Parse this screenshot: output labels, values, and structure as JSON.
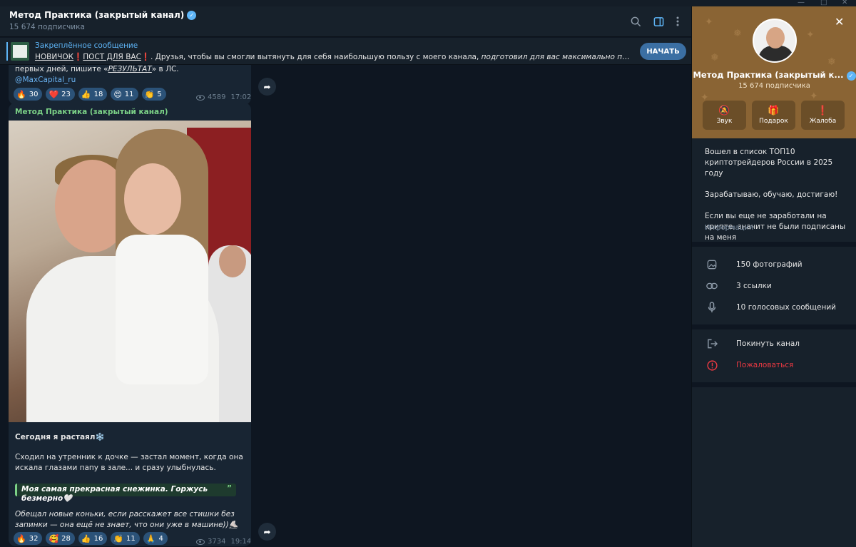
{
  "window": {
    "controls": [
      "—",
      "□",
      "✕"
    ]
  },
  "header": {
    "title": "Метод Практика (закрытый канал)",
    "subscribers": "15 674 подписчика"
  },
  "pinned": {
    "label": "Закреплённое сообщение",
    "part1": "НОВИЧОК",
    "part2": "ПОСТ ДЛЯ ВАС",
    "part3": ". Друзья, чтобы вы смогли вытянуть для себя наибольшую пользу с моего канала, ",
    "part4": "подготовил для вас максимально подробный гайд с от...",
    "button": "НАЧАТЬ"
  },
  "message1": {
    "line_a": "первых дней, пишите «",
    "line_b": "РЕЗУЛЬТАТ",
    "line_c": "» в ЛС.",
    "link": "@MaxCapital_ru",
    "reactions": [
      {
        "emoji": "🔥",
        "count": "30"
      },
      {
        "emoji": "❤️",
        "count": "23"
      },
      {
        "emoji": "👍",
        "count": "18"
      },
      {
        "emoji": "😍",
        "count": "11"
      },
      {
        "emoji": "👏",
        "count": "5"
      }
    ],
    "views": "4589",
    "time": "17:02"
  },
  "message2": {
    "author": "Метод Практика (закрытый канал)",
    "title": "Сегодня я растаял❄️",
    "body": "Сходил на утренник к дочке — застал момент, когда она искала глазами папу в зале... и сразу улыбнулась.",
    "quote": "Моя самая прекрасная снежинка. Горжусь безмерно🤍",
    "quote_mark": "”",
    "closing": "Обещал новые коньки, если расскажет все стишки без запинки — она ещё не знает, что они уже в машине))⛸️",
    "reactions": [
      {
        "emoji": "🔥",
        "count": "32"
      },
      {
        "emoji": "🥰",
        "count": "28"
      },
      {
        "emoji": "👍",
        "count": "16"
      },
      {
        "emoji": "👏",
        "count": "11"
      },
      {
        "emoji": "🙏",
        "count": "4"
      }
    ],
    "views": "3734",
    "time": "19:14"
  },
  "panel": {
    "name": "Метод Практика (закрытый к...",
    "subscribers": "15 674 подписчика",
    "buttons": [
      {
        "icon": "mute-icon",
        "label": "Звук"
      },
      {
        "icon": "gift-icon",
        "label": "Подарок"
      },
      {
        "icon": "report-icon",
        "label": "Жалоба"
      }
    ],
    "description_1": "Вошел в список ТОП10 криптотрейдеров России в 2025 году",
    "description_2": "Зарабатываю, обучаю, достигаю!",
    "description_3": "Если вы еще не заработали на крипте, значит не были подписаны на меня",
    "info_label": "Информация",
    "media": [
      {
        "icon": "photo-icon",
        "label": "150 фотографий"
      },
      {
        "icon": "link-icon",
        "label": "3 ссылки"
      },
      {
        "icon": "mic-icon",
        "label": "10 голосовых сообщений"
      }
    ],
    "actions": [
      {
        "icon": "leave-icon",
        "label": "Покинуть канал"
      },
      {
        "icon": "warning-icon",
        "label": "Пожаловаться"
      }
    ]
  },
  "colors": {
    "accent": "#5eb5f7",
    "bubble": "#182533",
    "panel_banner": "#8a6434",
    "danger": "#ec3942",
    "author": "#7cd287"
  }
}
